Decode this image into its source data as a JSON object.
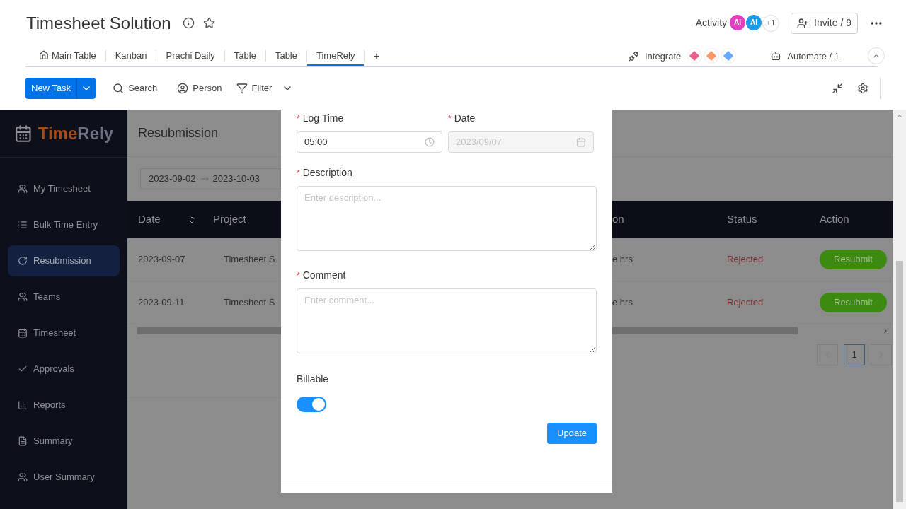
{
  "board": {
    "title": "Timesheet Solution",
    "activity": "Activity",
    "avatars": [
      {
        "initials": "AI",
        "color": "#e040c0"
      },
      {
        "initials": "AI",
        "color": "#1e9be9"
      }
    ],
    "avatar_more": "+1",
    "invite": "Invite / 9",
    "views": [
      {
        "label": "Main Table",
        "selected": false
      },
      {
        "label": "Kanban",
        "selected": false
      },
      {
        "label": "Prachi Daily",
        "selected": false
      },
      {
        "label": "Table",
        "selected": false
      },
      {
        "label": "Table",
        "selected": false
      },
      {
        "label": "TimeRely",
        "selected": true
      }
    ],
    "add_view": "+",
    "integrate": "Integrate",
    "automate": "Automate / 1"
  },
  "toolbar": {
    "new_task": "New Task",
    "search": "Search",
    "person": "Person",
    "filter": "Filter"
  },
  "sidebar": {
    "logo_first": "Time",
    "logo_second": "Rely",
    "items": [
      {
        "label": "My Timesheet",
        "selected": false
      },
      {
        "label": "Bulk Time Entry",
        "selected": false
      },
      {
        "label": "Resubmission",
        "selected": true
      },
      {
        "label": "Teams",
        "selected": false
      },
      {
        "label": "Timesheet",
        "selected": false
      },
      {
        "label": "Approvals",
        "selected": false
      },
      {
        "label": "Reports",
        "selected": false
      },
      {
        "label": "Summary",
        "selected": false
      },
      {
        "label": "User Summary",
        "selected": false
      }
    ]
  },
  "page": {
    "title": "Resubmission",
    "date_from": "2023-09-02",
    "date_to": "2023-10-03"
  },
  "table": {
    "left_columns": [
      "Date",
      "Project"
    ],
    "right_columns": [
      "on",
      "Status",
      "Action"
    ],
    "rows": [
      {
        "date": "2023-09-07",
        "project": "Timesheet S",
        "column_3": "e hrs",
        "status": "Rejected",
        "action": "Resubmit"
      },
      {
        "date": "2023-09-11",
        "project": "Timesheet S",
        "column_3": "e hrs",
        "status": "Rejected",
        "action": "Resubmit"
      }
    ]
  },
  "pagination": {
    "page": "1"
  },
  "form": {
    "log_time": {
      "mark": "*",
      "label": "Log Time",
      "value": "05:00"
    },
    "date": {
      "mark": "*",
      "label": "Date",
      "value": "2023/09/07",
      "disabled": true
    },
    "description": {
      "mark": "*",
      "label": "Description",
      "placeholder": "Enter description..."
    },
    "comment": {
      "mark": "*",
      "label": "Comment",
      "placeholder": "Enter comment..."
    },
    "billable": {
      "label": "Billable",
      "on": true
    },
    "submit": "Update"
  }
}
